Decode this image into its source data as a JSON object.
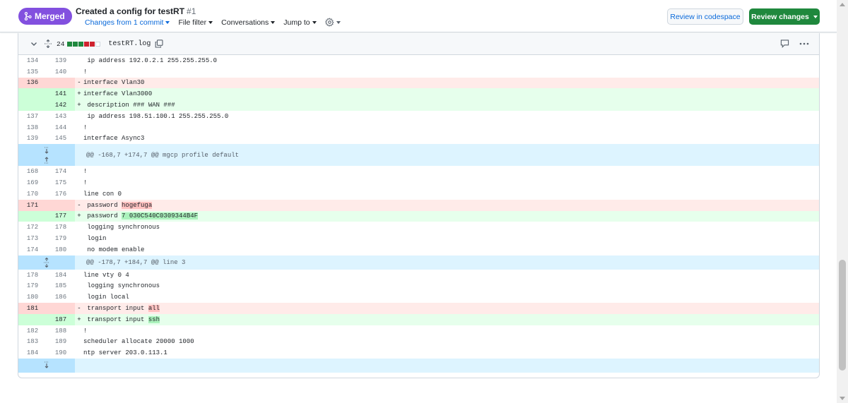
{
  "header": {
    "status_badge": "Merged",
    "title": "Created a config for testRT",
    "pr_number": "#1",
    "nav": {
      "changes": "Changes from 1 commit",
      "file_filter": "File filter",
      "conversations": "Conversations",
      "jump_to": "Jump to"
    },
    "review_codespace": "Review in codespace",
    "review_changes": "Review changes"
  },
  "file": {
    "changes_count": "24",
    "name": "testRT.log"
  },
  "colors": {
    "merged": "#8250df",
    "primary_button": "#1f883d",
    "link": "#0969da",
    "deletion_bg": "#ffebe9",
    "addition_bg": "#e6ffec",
    "hunk_bg": "#ddf4ff"
  },
  "diff": {
    "r1": {
      "old": "134",
      "new": "139",
      "sign": "",
      "code": " ip address 192.0.2.1 255.255.255.0"
    },
    "r2": {
      "old": "135",
      "new": "140",
      "sign": "",
      "code": "!"
    },
    "r3": {
      "old": "136",
      "new": "",
      "sign": "-",
      "code": "interface Vlan30"
    },
    "r4": {
      "old": "",
      "new": "141",
      "sign": "+",
      "code": "interface Vlan3000"
    },
    "r5": {
      "old": "",
      "new": "142",
      "sign": "+",
      "code": " description ### WAN ###"
    },
    "r6": {
      "old": "137",
      "new": "143",
      "sign": "",
      "code": " ip address 198.51.100.1 255.255.255.0"
    },
    "r7": {
      "old": "138",
      "new": "144",
      "sign": "",
      "code": "!"
    },
    "r8": {
      "old": "139",
      "new": "145",
      "sign": "",
      "code": "interface Async3"
    },
    "hunk1": "@@ -168,7 +174,7 @@ mgcp profile default",
    "r9": {
      "old": "168",
      "new": "174",
      "sign": "",
      "code": "!"
    },
    "r10": {
      "old": "169",
      "new": "175",
      "sign": "",
      "code": "!"
    },
    "r11": {
      "old": "170",
      "new": "176",
      "sign": "",
      "code": "line con 0"
    },
    "r12": {
      "old": "171",
      "new": "",
      "sign": "-",
      "prefix": " password ",
      "hl": "hogefuga"
    },
    "r13": {
      "old": "",
      "new": "177",
      "sign": "+",
      "prefix": " password ",
      "hl": "7 030C540C0309344B4F"
    },
    "r14": {
      "old": "172",
      "new": "178",
      "sign": "",
      "code": " logging synchronous"
    },
    "r15": {
      "old": "173",
      "new": "179",
      "sign": "",
      "code": " login"
    },
    "r16": {
      "old": "174",
      "new": "180",
      "sign": "",
      "code": " no modem enable"
    },
    "hunk2": "@@ -178,7 +184,7 @@ line 3",
    "r17": {
      "old": "178",
      "new": "184",
      "sign": "",
      "code": "line vty 0 4"
    },
    "r18": {
      "old": "179",
      "new": "185",
      "sign": "",
      "code": " logging synchronous"
    },
    "r19": {
      "old": "180",
      "new": "186",
      "sign": "",
      "code": " login local"
    },
    "r20": {
      "old": "181",
      "new": "",
      "sign": "-",
      "prefix": " transport input ",
      "hl": "all"
    },
    "r21": {
      "old": "",
      "new": "187",
      "sign": "+",
      "prefix": " transport input ",
      "hl": "ssh"
    },
    "r22": {
      "old": "182",
      "new": "188",
      "sign": "",
      "code": "!"
    },
    "r23": {
      "old": "183",
      "new": "189",
      "sign": "",
      "code": "scheduler allocate 20000 1000"
    },
    "r24": {
      "old": "184",
      "new": "190",
      "sign": "",
      "code": "ntp server 203.0.113.1"
    }
  }
}
